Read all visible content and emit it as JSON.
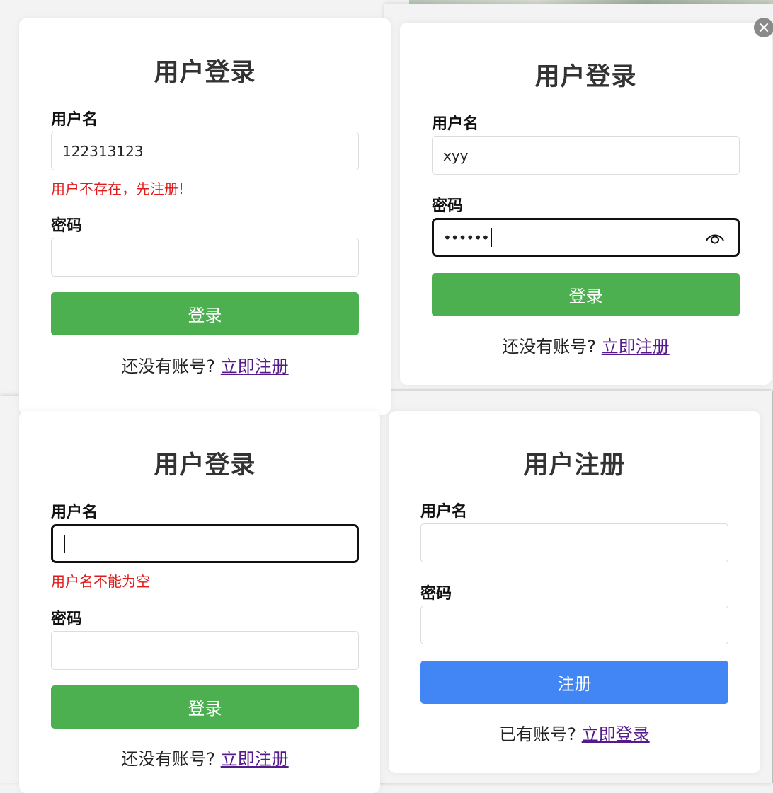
{
  "cards": [
    {
      "title": "用户登录",
      "username_label": "用户名",
      "username_value": "122313123",
      "username_error": "用户不存在，先注册!",
      "password_label": "密码",
      "password_value": "",
      "button_label": "登录",
      "footer_text": "还没有账号?",
      "footer_link": "立即注册"
    },
    {
      "title": "用户登录",
      "username_label": "用户名",
      "username_value": "xyy",
      "password_label": "密码",
      "password_value": "••••••",
      "button_label": "登录",
      "footer_text": "还没有账号?",
      "footer_link": "立即注册"
    },
    {
      "title": "用户登录",
      "username_label": "用户名",
      "username_value": "",
      "username_error": "用户名不能为空",
      "password_label": "密码",
      "password_value": "",
      "button_label": "登录",
      "footer_text": "还没有账号?",
      "footer_link": "立即注册"
    },
    {
      "title": "用户注册",
      "username_label": "用户名",
      "username_value": "",
      "password_label": "密码",
      "password_value": "",
      "button_label": "注册",
      "footer_text": "已有账号?",
      "footer_link": "立即登录"
    }
  ],
  "colors": {
    "login_button": "#4caf50",
    "register_button": "#4285f4",
    "error_text": "#e11b1b",
    "link": "#551a8b"
  },
  "icons": {
    "password_toggle": "eye-icon",
    "dismiss": "close-icon"
  }
}
